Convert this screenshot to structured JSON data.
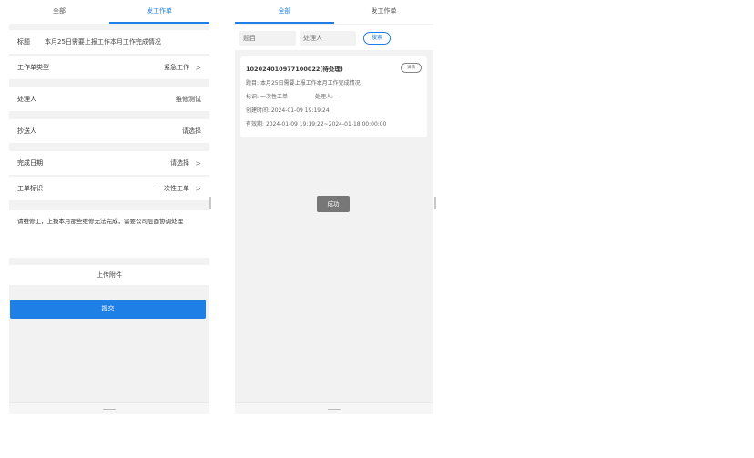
{
  "left_panel": {
    "tabs": [
      "全部",
      "发工作单"
    ],
    "rows": {
      "title_label": "标题",
      "title_value": "本月25日需要上报工作本月工作完成情况",
      "type_label": "工作单类型",
      "type_value": "紧急工作",
      "handler_label": "处理人",
      "handler_value": "维修测试",
      "cc_label": "抄送人",
      "cc_value": "请选择",
      "date_label": "完成日期",
      "date_value": "请选择",
      "tag_label": "工单标识",
      "tag_value": "一次性工单"
    },
    "content": "请维修工，上报本月那些维修无法完成，需要公司层面协调处理",
    "upload_label": "上传附件",
    "submit_label": "提交"
  },
  "right_panel": {
    "tabs": [
      "全部",
      "发工作单"
    ],
    "search": {
      "title_placeholder": "题目",
      "handler_placeholder": "处理人",
      "button": "搜索"
    },
    "card": {
      "title": "102024010977100022(待处理)",
      "detail_button": "详情",
      "topic_label": "题目:",
      "topic_value": "本月25日需要上报工作本月工作完成情况",
      "tag_label": "标识:",
      "tag_value": "一次性工单",
      "handler_label": "处理人:",
      "handler_value": "-",
      "created_label": "创建时间:",
      "created_value": "2024-01-09 19:19:24",
      "valid_label": "有效期:",
      "valid_value": "2024-01-09 19:19:22~2024-01-18 00:00:00"
    },
    "toast": "成功"
  },
  "colors": {
    "accent": "#1e7fe6",
    "background": "#f2f2f2"
  }
}
